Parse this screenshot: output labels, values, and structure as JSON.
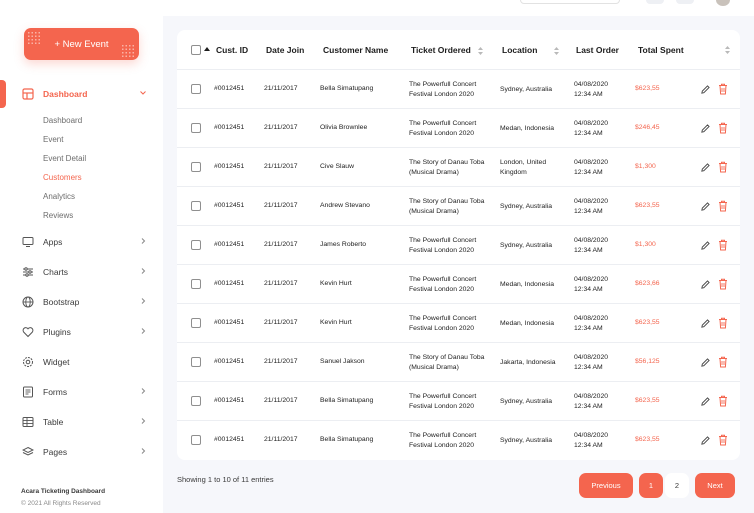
{
  "sidebar": {
    "new_event_label": "+ New Event",
    "nav": [
      {
        "label": "Dashboard",
        "icon": "dashboard-icon",
        "active": true,
        "chevron": "down"
      },
      {
        "label": "Apps",
        "icon": "monitor-icon",
        "chevron": "right"
      },
      {
        "label": "Charts",
        "icon": "sliders-icon",
        "chevron": "right"
      },
      {
        "label": "Bootstrap",
        "icon": "globe-icon",
        "chevron": "right"
      },
      {
        "label": "Plugins",
        "icon": "heart-icon",
        "chevron": "right"
      },
      {
        "label": "Widget",
        "icon": "gear-icon"
      },
      {
        "label": "Forms",
        "icon": "form-icon",
        "chevron": "right"
      },
      {
        "label": "Table",
        "icon": "table-icon",
        "chevron": "right"
      },
      {
        "label": "Pages",
        "icon": "layers-icon",
        "chevron": "right"
      }
    ],
    "dashboard_sub": [
      {
        "label": "Dashboard"
      },
      {
        "label": "Event"
      },
      {
        "label": "Event Detail"
      },
      {
        "label": "Customers",
        "active": true
      },
      {
        "label": "Analytics"
      },
      {
        "label": "Reviews"
      }
    ],
    "footer_title": "Acara Ticketing Dashboard",
    "footer_copy": "© 2021 All Rights Reserved"
  },
  "table": {
    "headers": {
      "cust_id": "Cust. ID",
      "date_join": "Date Join",
      "customer_name": "Customer Name",
      "ticket_ordered": "Ticket Ordered",
      "location": "Location",
      "last_order": "Last Order",
      "total_spent": "Total Spent"
    },
    "rows": [
      {
        "id": "#0012451",
        "date": "21/11/2017",
        "name": "Bella Simatupang",
        "ticket1": "The Powerfull Concert",
        "ticket2": "Festival London 2020",
        "loc1": "Sydney, Australia",
        "loc2": "",
        "order1": "04/08/2020",
        "order2": "12:34 AM",
        "spent": "$623,55"
      },
      {
        "id": "#0012451",
        "date": "21/11/2017",
        "name": "Olivia Brownlee",
        "ticket1": "The Powerfull Concert",
        "ticket2": "Festival London 2020",
        "loc1": "Medan, Indonesia",
        "loc2": "",
        "order1": "04/08/2020",
        "order2": "12:34 AM",
        "spent": "$246,45"
      },
      {
        "id": "#0012451",
        "date": "21/11/2017",
        "name": "Cive Slauw",
        "ticket1": "The Story of Danau Toba",
        "ticket2": "(Musical Drama)",
        "loc1": "London, United",
        "loc2": "Kingdom",
        "order1": "04/08/2020",
        "order2": "12:34 AM",
        "spent": "$1,300"
      },
      {
        "id": "#0012451",
        "date": "21/11/2017",
        "name": "Andrew Stevano",
        "ticket1": "The Story of Danau Toba",
        "ticket2": "(Musical Drama)",
        "loc1": "Sydney, Australia",
        "loc2": "",
        "order1": "04/08/2020",
        "order2": "12:34 AM",
        "spent": "$623,55"
      },
      {
        "id": "#0012451",
        "date": "21/11/2017",
        "name": "James Roberto",
        "ticket1": "The Powerfull Concert",
        "ticket2": "Festival London 2020",
        "loc1": "Sydney, Australia",
        "loc2": "",
        "order1": "04/08/2020",
        "order2": "12:34 AM",
        "spent": "$1,300"
      },
      {
        "id": "#0012451",
        "date": "21/11/2017",
        "name": "Kevin Hurt",
        "ticket1": "The Powerfull Concert",
        "ticket2": "Festival London 2020",
        "loc1": "Medan, Indonesia",
        "loc2": "",
        "order1": "04/08/2020",
        "order2": "12:34 AM",
        "spent": "$623,66"
      },
      {
        "id": "#0012451",
        "date": "21/11/2017",
        "name": "Kevin Hurt",
        "ticket1": "The Powerfull Concert",
        "ticket2": "Festival London 2020",
        "loc1": "Medan, Indonesia",
        "loc2": "",
        "order1": "04/08/2020",
        "order2": "12:34 AM",
        "spent": "$623,55"
      },
      {
        "id": "#0012451",
        "date": "21/11/2017",
        "name": "Sanuel Jakson",
        "ticket1": "The Story of Danau Toba",
        "ticket2": "(Musical Drama)",
        "loc1": "Jakarta, Indonesia",
        "loc2": "",
        "order1": "04/08/2020",
        "order2": "12:34 AM",
        "spent": "$56,125"
      },
      {
        "id": "#0012451",
        "date": "21/11/2017",
        "name": "Bella Simatupang",
        "ticket1": "The Powerfull Concert",
        "ticket2": "Festival London 2020",
        "loc1": "Sydney, Australia",
        "loc2": "",
        "order1": "04/08/2020",
        "order2": "12:34 AM",
        "spent": "$623,55"
      },
      {
        "id": "#0012451",
        "date": "21/11/2017",
        "name": "Bella Simatupang",
        "ticket1": "The Powerfull Concert",
        "ticket2": "Festival London 2020",
        "loc1": "Sydney, Australia",
        "loc2": "",
        "order1": "04/08/2020",
        "order2": "12:34 AM",
        "spent": "$623,55"
      }
    ]
  },
  "footer": {
    "entries_text": "Showing 1 to 10 of 11 entries"
  },
  "pagination": {
    "previous": "Previous",
    "pages": [
      "1",
      "2"
    ],
    "next": "Next"
  },
  "colors": {
    "accent": "#f4654e",
    "background": "#f6f7fb",
    "card": "#ffffff"
  }
}
